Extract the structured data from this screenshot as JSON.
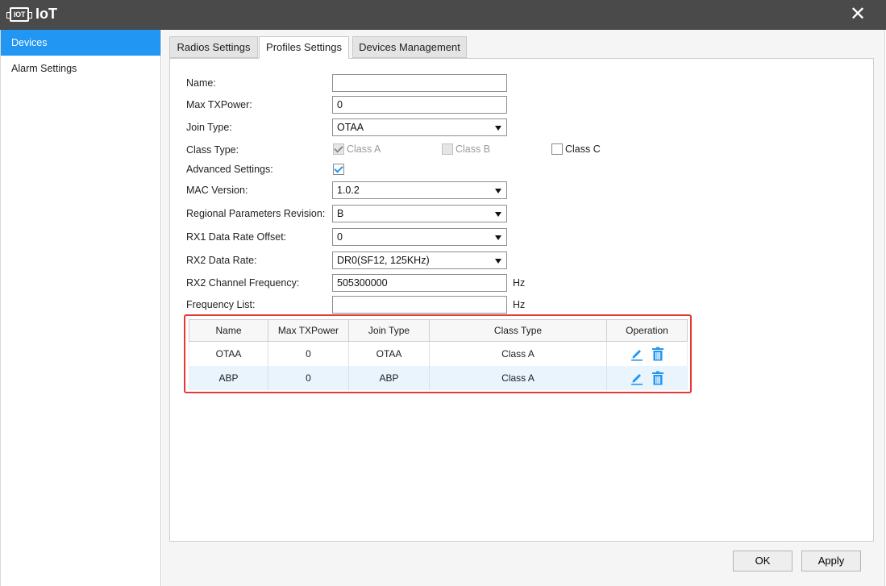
{
  "window": {
    "icon_text": "IOT",
    "title": "IoT",
    "close_glyph": "✕"
  },
  "sidebar": {
    "items": [
      {
        "label": "Devices"
      },
      {
        "label": "Alarm Settings"
      }
    ]
  },
  "tabs": [
    {
      "label": "Radios Settings"
    },
    {
      "label": "Profiles Settings"
    },
    {
      "label": "Devices Management"
    }
  ],
  "form": {
    "name": {
      "label": "Name:",
      "value": ""
    },
    "max_txpower": {
      "label": "Max TXPower:",
      "value": "0"
    },
    "join_type": {
      "label": "Join Type:",
      "value": "OTAA"
    },
    "class_type": {
      "label": "Class Type:",
      "options": [
        {
          "label": "Class A",
          "checked": true,
          "disabled": true
        },
        {
          "label": "Class B",
          "checked": false,
          "disabled": true
        },
        {
          "label": "Class C",
          "checked": false,
          "disabled": false
        }
      ]
    },
    "advanced": {
      "label": "Advanced Settings:",
      "checked": true
    },
    "mac_version": {
      "label": "MAC Version:",
      "value": "1.0.2"
    },
    "regional": {
      "label": "Regional Parameters Revision:",
      "value": "B"
    },
    "rx1_offset": {
      "label": "RX1 Data Rate Offset:",
      "value": "0"
    },
    "rx2_rate": {
      "label": "RX2 Data Rate:",
      "value": "DR0(SF12, 125KHz)"
    },
    "rx2_freq": {
      "label": "RX2 Channel Frequency:",
      "value": "505300000",
      "unit": "Hz"
    },
    "freq_list": {
      "label": "Frequency List:",
      "value": "",
      "unit": "Hz"
    }
  },
  "table": {
    "headers": [
      "Name",
      "Max TXPower",
      "Join Type",
      "Class Type",
      "Operation"
    ],
    "rows": [
      [
        "OTAA",
        "0",
        "OTAA",
        "Class A"
      ],
      [
        "ABP",
        "0",
        "ABP",
        "Class A"
      ]
    ]
  },
  "buttons": {
    "ok": "OK",
    "apply": "Apply"
  },
  "colors": {
    "accent": "#2196f3",
    "highlight_border": "#e53935",
    "titlebar": "#4a4a4a"
  },
  "icons": {
    "edit": "pencil-icon",
    "delete": "trash-icon"
  }
}
